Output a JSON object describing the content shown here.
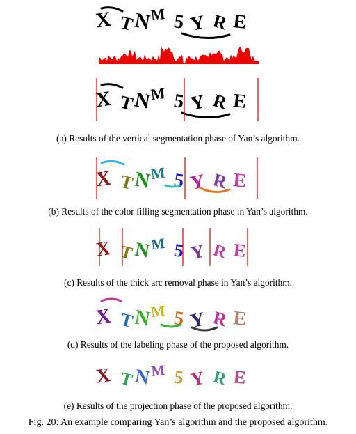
{
  "captcha": {
    "glyphs": [
      "X",
      "T",
      "N",
      "M",
      "5",
      "Y",
      "R",
      "E"
    ]
  },
  "captions": {
    "a": "(a) Results of the vertical segmentation phase of Yan’s algorithm.",
    "b": "(b) Results of the color filling segmentation phase in Yan’s algorithm.",
    "c": "(c) Results of the thick arc removal phase in Yan’s algorithm.",
    "d": "(d) Results of the labeling phase of the proposed algorithm.",
    "e": "(e) Results of the projection phase of the proposed algorithm."
  },
  "figure_caption": "Fig. 20: An example comparing Yan’s algorithm and the proposed algorithm.",
  "colors": {
    "ink": "#000000",
    "segment_line": "#e00000",
    "histogram": "#ee0000",
    "phase_b": [
      "#8b1a1a",
      "#7a7a10",
      "#1f8f1f",
      "#1a7f7f",
      "#2020c0",
      "#c01c9c",
      "#7e3fa8",
      "#c040a0"
    ],
    "phase_c": [
      "#8b1a1a",
      "#7a7a10",
      "#1f8f1f",
      "#1a6f7f",
      "#2020b0",
      "#7a3a9a",
      "#c040a0"
    ],
    "phase_d": [
      "#7a1f8f",
      "#1f70b0",
      "#3bb02a",
      "#c8b81a",
      "#d06a1a",
      "#2a2a6a",
      "#c0309a",
      "#b08070"
    ],
    "phase_e": [
      "#8b1a2a",
      "#2aa04a",
      "#3a6ac0",
      "#9a4ac0",
      "#c8a03a",
      "#c03080",
      "#30a070",
      "#b04a8a"
    ]
  }
}
